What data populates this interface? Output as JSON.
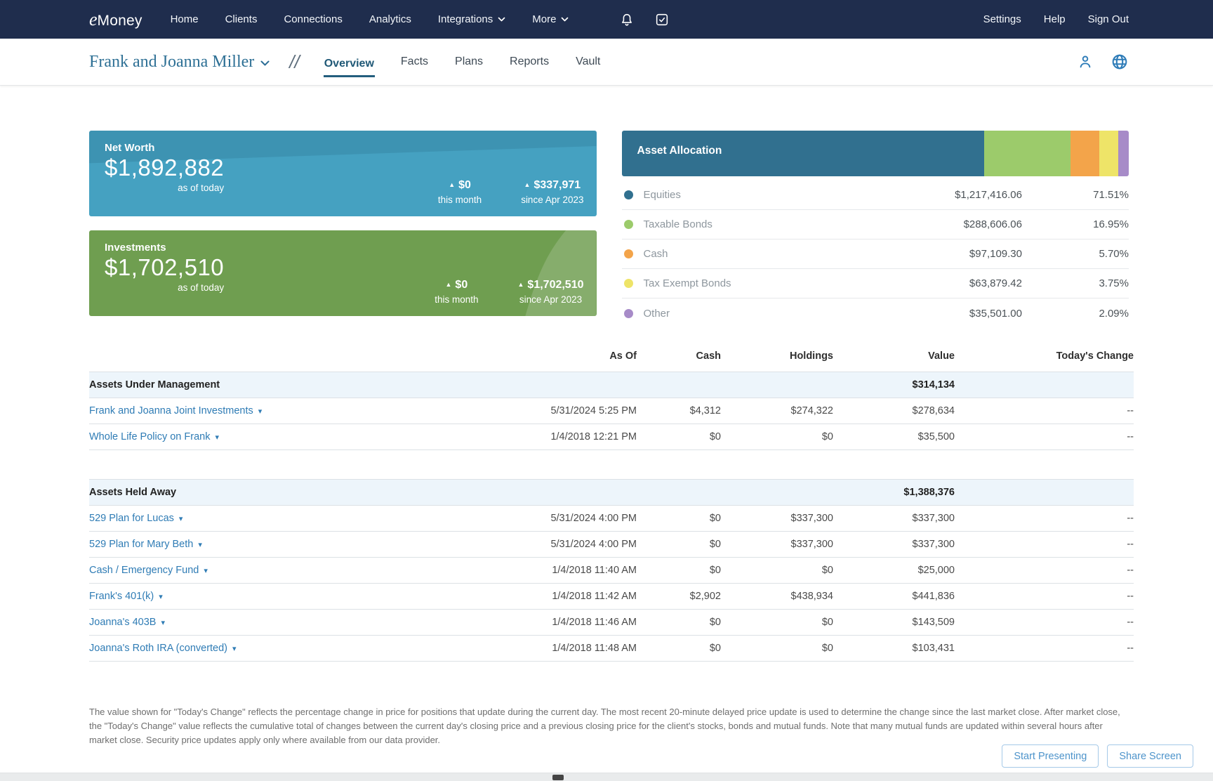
{
  "icons": {
    "up_triangle": "▲",
    "caret_down": "▾"
  },
  "topnav": {
    "brand": {
      "prefix": "e",
      "name": "Money"
    },
    "links": [
      {
        "label": "Home"
      },
      {
        "label": "Clients"
      },
      {
        "label": "Connections"
      },
      {
        "label": "Analytics"
      }
    ],
    "menus": [
      {
        "label": "Integrations"
      },
      {
        "label": "More"
      }
    ],
    "right_links": [
      {
        "label": "Settings"
      },
      {
        "label": "Help"
      },
      {
        "label": "Sign Out"
      }
    ]
  },
  "client_header": {
    "client_name": "Frank and Joanna Miller",
    "separator": "//",
    "tabs": [
      {
        "label": "Overview",
        "active": true
      },
      {
        "label": "Facts"
      },
      {
        "label": "Plans"
      },
      {
        "label": "Reports"
      },
      {
        "label": "Vault"
      }
    ]
  },
  "summary_cards": {
    "net_worth": {
      "title": "Net Worth",
      "amount": "$1,892,882",
      "as_of_label": "as of today",
      "month_change": "$0",
      "month_label": "this month",
      "since_change": "$337,971",
      "since_label": "since Apr 2023",
      "color": "#45A1C1"
    },
    "investments": {
      "title": "Investments",
      "amount": "$1,702,510",
      "as_of_label": "as of today",
      "month_change": "$0",
      "month_label": "this month",
      "since_change": "$1,702,510",
      "since_label": "since Apr 2023",
      "color": "#6F9E50"
    }
  },
  "asset_allocation": {
    "title": "Asset Allocation",
    "segments": [
      {
        "label": "Equities",
        "value": "$1,217,416.06",
        "percent_label": "71.51%",
        "percent": 71.51,
        "color": "#31708F"
      },
      {
        "label": "Taxable Bonds",
        "value": "$288,606.06",
        "percent_label": "16.95%",
        "percent": 16.95,
        "color": "#9CCB6B"
      },
      {
        "label": "Cash",
        "value": "$97,109.30",
        "percent_label": "5.70%",
        "percent": 5.7,
        "color": "#F3A44A"
      },
      {
        "label": "Tax Exempt Bonds",
        "value": "$63,879.42",
        "percent_label": "3.75%",
        "percent": 3.75,
        "color": "#EEE468"
      },
      {
        "label": "Other",
        "value": "$35,501.00",
        "percent_label": "2.09%",
        "percent": 2.09,
        "color": "#A78BC8"
      }
    ]
  },
  "accounts_table": {
    "headers": {
      "as_of": "As Of",
      "cash": "Cash",
      "holdings": "Holdings",
      "value": "Value",
      "change": "Today's Change"
    },
    "sections": [
      {
        "name": "Assets Under Management",
        "total": "$314,134",
        "rows": [
          {
            "name": "Frank and Joanna Joint Investments",
            "as_of": "5/31/2024 5:25 PM",
            "cash": "$4,312",
            "holdings": "$274,322",
            "value": "$278,634",
            "change": "--"
          },
          {
            "name": "Whole Life Policy on Frank",
            "as_of": "1/4/2018 12:21 PM",
            "cash": "$0",
            "holdings": "$0",
            "value": "$35,500",
            "change": "--"
          }
        ]
      },
      {
        "name": "Assets Held Away",
        "total": "$1,388,376",
        "rows": [
          {
            "name": "529 Plan for Lucas",
            "as_of": "5/31/2024 4:00 PM",
            "cash": "$0",
            "holdings": "$337,300",
            "value": "$337,300",
            "change": "--"
          },
          {
            "name": "529 Plan for Mary Beth",
            "as_of": "5/31/2024 4:00 PM",
            "cash": "$0",
            "holdings": "$337,300",
            "value": "$337,300",
            "change": "--"
          },
          {
            "name": "Cash / Emergency Fund",
            "as_of": "1/4/2018 11:40 AM",
            "cash": "$0",
            "holdings": "$0",
            "value": "$25,000",
            "change": "--"
          },
          {
            "name": "Frank's 401(k)",
            "as_of": "1/4/2018 11:42 AM",
            "cash": "$2,902",
            "holdings": "$438,934",
            "value": "$441,836",
            "change": "--"
          },
          {
            "name": "Joanna's 403B",
            "as_of": "1/4/2018 11:46 AM",
            "cash": "$0",
            "holdings": "$0",
            "value": "$143,509",
            "change": "--"
          },
          {
            "name": "Joanna's Roth IRA (converted)",
            "as_of": "1/4/2018 11:48 AM",
            "cash": "$0",
            "holdings": "$0",
            "value": "$103,431",
            "change": "--"
          }
        ]
      }
    ]
  },
  "footer": {
    "disclaimer": "The value shown for \"Today's Change\" reflects the percentage change in price for positions that update during the current day. The most recent 20-minute delayed price update is used to determine the change since the last market close. After market close, the \"Today's Change\" value reflects the cumulative total of changes between the current day's closing price and a previous closing price for the client's stocks, bonds and mutual funds. Note that many mutual funds are updated within several hours after market close. Security price updates apply only where available from our data provider.",
    "buttons": [
      {
        "label": "Start Presenting"
      },
      {
        "label": "Share Screen"
      }
    ]
  }
}
